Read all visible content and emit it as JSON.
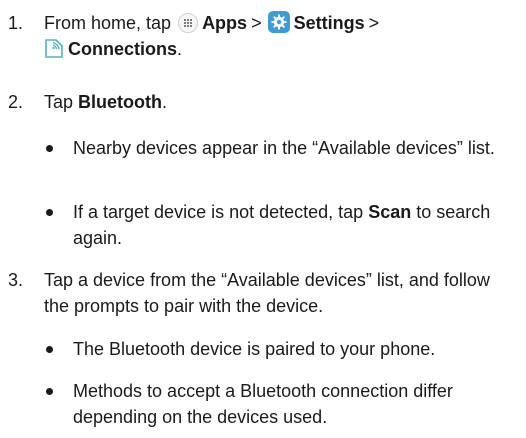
{
  "steps": [
    {
      "number": "1.",
      "prefix": "From home, tap",
      "apps_label": "Apps",
      "settings_label": "Settings",
      "connections_label": "Connections",
      "separator": ">",
      "suffix": "."
    },
    {
      "number": "2.",
      "prefix": "Tap",
      "bold": "Bluetooth",
      "suffix": "."
    },
    {
      "number": "3.",
      "text": "Tap a device from the “Available devices” list, and follow the prompts to pair with the device."
    }
  ],
  "bullets": [
    {
      "text": "Nearby devices appear in the “Available devices” list."
    },
    {
      "prefix": "If a target device is not detected, tap",
      "bold": "Scan",
      "suffix": "to search again."
    },
    {
      "text": "The Bluetooth device is paired to your phone."
    },
    {
      "text": "Methods to accept a Bluetooth connection differ depending on the devices used."
    }
  ],
  "icons": {
    "apps": "apps-icon",
    "settings": "settings-gear-icon",
    "connections": "connections-icon",
    "settings_color": "#3d9bd8",
    "connections_color": "#4fb3c4"
  }
}
